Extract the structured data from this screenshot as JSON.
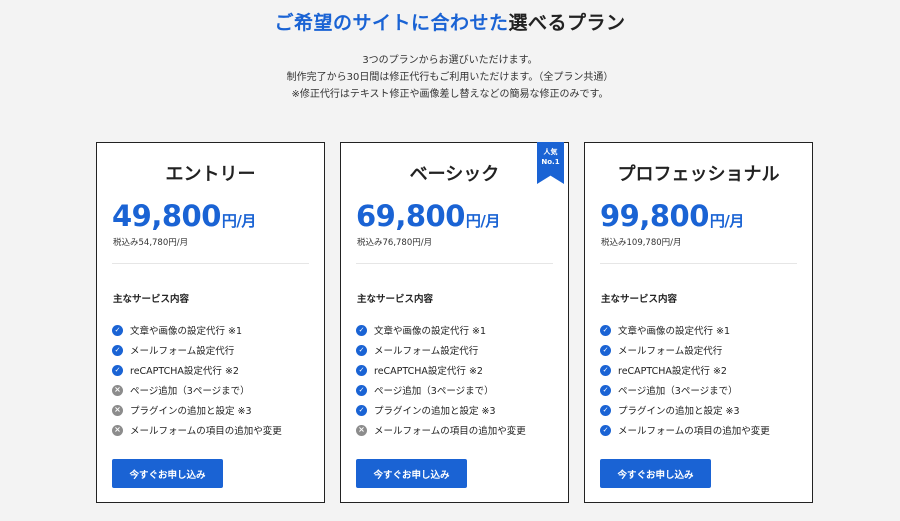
{
  "headline": {
    "highlight": "ご希望のサイトに合わせた",
    "rest": "選べるプラン"
  },
  "intro": {
    "line1": "3つのプランからお選びいただけます。",
    "line2": "制作完了から30日間は修正代行もご利用いただけます。（全プラン共通）",
    "line3": "※修正代行はテキスト修正や画像差し替えなどの簡易な修正のみです。"
  },
  "services_heading": "主なサービス内容",
  "cta_label": "今すぐお申し込み",
  "ribbon": {
    "line1": "人気",
    "line2": "No.1"
  },
  "plans": [
    {
      "name": "エントリー",
      "price": "49,800",
      "unit": "円/月",
      "tax": "税込み54,780円/月",
      "services": [
        {
          "label": "文章や画像の設定代行 ※1",
          "included": true
        },
        {
          "label": "メールフォーム設定代行",
          "included": true
        },
        {
          "label": "reCAPTCHA設定代行 ※2",
          "included": true
        },
        {
          "label": "ページ追加（3ページまで）",
          "included": false
        },
        {
          "label": "プラグインの追加と設定 ※3",
          "included": false
        },
        {
          "label": "メールフォームの項目の追加や変更",
          "included": false
        }
      ]
    },
    {
      "name": "ベーシック",
      "price": "69,800",
      "unit": "円/月",
      "tax": "税込み76,780円/月",
      "services": [
        {
          "label": "文章や画像の設定代行 ※1",
          "included": true
        },
        {
          "label": "メールフォーム設定代行",
          "included": true
        },
        {
          "label": "reCAPTCHA設定代行 ※2",
          "included": true
        },
        {
          "label": "ページ追加（3ページまで）",
          "included": true
        },
        {
          "label": "プラグインの追加と設定 ※3",
          "included": true
        },
        {
          "label": "メールフォームの項目の追加や変更",
          "included": false
        }
      ]
    },
    {
      "name": "プロフェッショナル",
      "price": "99,800",
      "unit": "円/月",
      "tax": "税込み109,780円/月",
      "services": [
        {
          "label": "文章や画像の設定代行 ※1",
          "included": true
        },
        {
          "label": "メールフォーム設定代行",
          "included": true
        },
        {
          "label": "reCAPTCHA設定代行 ※2",
          "included": true
        },
        {
          "label": "ページ追加（3ページまで）",
          "included": true
        },
        {
          "label": "プラグインの追加と設定 ※3",
          "included": true
        },
        {
          "label": "メールフォームの項目の追加や変更",
          "included": true
        }
      ]
    }
  ],
  "colors": {
    "accent": "#1a63d4",
    "excluded": "#8c8c8c",
    "background": "#f3f3f3"
  },
  "icons": {
    "included": "check-circle-icon",
    "excluded": "x-circle-icon"
  }
}
